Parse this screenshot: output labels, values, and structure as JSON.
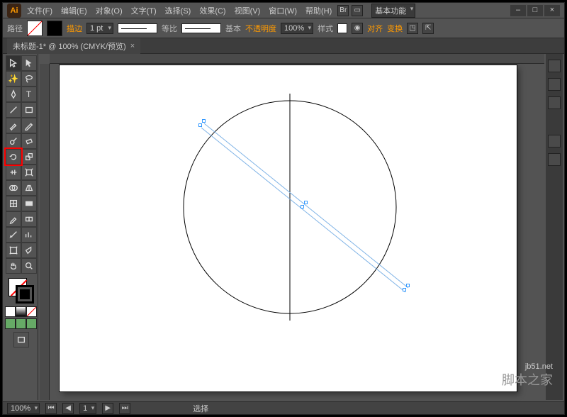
{
  "app": {
    "logo": "Ai",
    "essentials": "基本功能"
  },
  "menu": {
    "file": "文件(F)",
    "edit": "编辑(E)",
    "object": "对象(O)",
    "type": "文字(T)",
    "select": "选择(S)",
    "effect": "效果(C)",
    "view": "视图(V)",
    "window": "窗口(W)",
    "help": "帮助(H)"
  },
  "ctrl": {
    "pathlabel": "路径",
    "stroke": "描边",
    "strokeweight": "1 pt",
    "uniform": "等比",
    "basic": "基本",
    "opacitylabel": "不透明度",
    "opacity": "100%",
    "style": "样式",
    "align": "对齐",
    "transform": "变换"
  },
  "tab": {
    "title": "未标题-1* @ 100% (CMYK/预览)"
  },
  "status": {
    "zoom": "100%",
    "mode": "选择"
  },
  "watermark": {
    "url": "jb51.net",
    "cn": "脚本之家"
  },
  "tools": {
    "selection": "V",
    "direct": "A",
    "wand": "Y",
    "lasso": "Q",
    "pen": "P",
    "type": "T",
    "line": "\\",
    "rect": "M",
    "brush": "B",
    "pencil": "N",
    "blob": "Sh",
    "eraser": "E",
    "rotate": "R",
    "scale": "S",
    "width": "W",
    "warp": "Wp",
    "free": "E",
    "shapeb": "Sb",
    "persp": "P",
    "mesh": "U",
    "grad": "G",
    "eyedrop": "I",
    "blend": "Bl",
    "symbol": "Sy",
    "graph": "J",
    "artb": "Ab",
    "slice": "K",
    "hand": "H",
    "zoom": "Z"
  }
}
